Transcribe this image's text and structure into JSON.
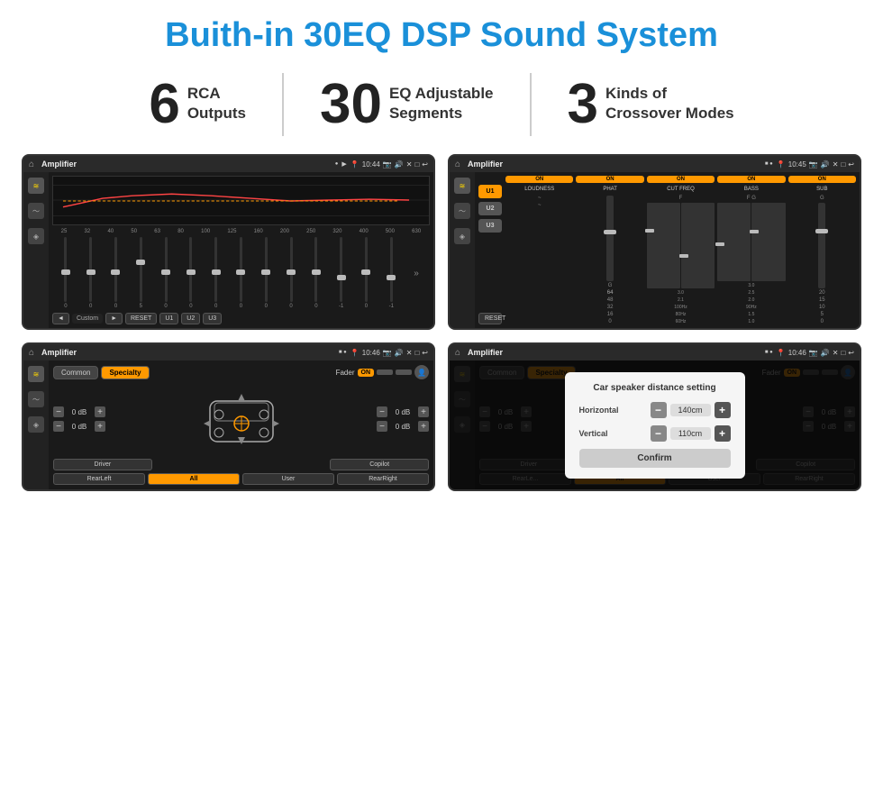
{
  "page": {
    "title": "Buith-in 30EQ DSP Sound System"
  },
  "stats": [
    {
      "number": "6",
      "line1": "RCA",
      "line2": "Outputs"
    },
    {
      "number": "30",
      "line1": "EQ Adjustable",
      "line2": "Segments"
    },
    {
      "number": "3",
      "line1": "Kinds of",
      "line2": "Crossover Modes"
    }
  ],
  "screens": {
    "eq": {
      "status_bar": {
        "app": "Amplifier",
        "time": "10:44"
      },
      "freq_labels": [
        "25",
        "32",
        "40",
        "50",
        "63",
        "80",
        "100",
        "125",
        "160",
        "200",
        "250",
        "320",
        "400",
        "500",
        "630"
      ],
      "slider_values": [
        "0",
        "0",
        "0",
        "5",
        "0",
        "0",
        "0",
        "0",
        "0",
        "0",
        "0",
        "-1",
        "0",
        "-1"
      ],
      "bottom_controls": [
        "◄",
        "Custom",
        "►",
        "RESET",
        "U1",
        "U2",
        "U3"
      ]
    },
    "amp": {
      "status_bar": {
        "app": "Amplifier",
        "time": "10:45"
      },
      "presets": [
        "U1",
        "U2",
        "U3"
      ],
      "controls": [
        {
          "toggle": "ON",
          "label": "LOUDNESS"
        },
        {
          "toggle": "ON",
          "label": "PHAT"
        },
        {
          "toggle": "ON",
          "label": "CUT FREQ"
        },
        {
          "toggle": "ON",
          "label": "BASS"
        },
        {
          "toggle": "ON",
          "label": "SUB"
        }
      ],
      "reset_label": "RESET"
    },
    "crossover": {
      "status_bar": {
        "app": "Amplifier",
        "time": "10:46"
      },
      "tabs": [
        "Common",
        "Specialty"
      ],
      "fader_label": "Fader",
      "fader_on": "ON",
      "db_rows": [
        {
          "value": "0 dB"
        },
        {
          "value": "0 dB"
        }
      ],
      "db_rows_right": [
        {
          "value": "0 dB"
        },
        {
          "value": "0 dB"
        }
      ],
      "bottom_btns": [
        "Driver",
        "",
        "",
        "User",
        "RearLeft",
        "All",
        "",
        "",
        "RearRight",
        "Copilot"
      ]
    },
    "dialog": {
      "status_bar": {
        "app": "Amplifier",
        "time": "10:46"
      },
      "tabs": [
        "Common",
        "Specialty"
      ],
      "dialog": {
        "title": "Car speaker distance setting",
        "horizontal_label": "Horizontal",
        "horizontal_value": "140cm",
        "vertical_label": "Vertical",
        "vertical_value": "110cm",
        "confirm_label": "Confirm"
      },
      "db_rows": [
        {
          "value": "0 dB"
        },
        {
          "value": "0 dB"
        }
      ]
    }
  },
  "icons": {
    "home": "⌂",
    "pin": "📍",
    "camera": "📷",
    "volume": "🔊",
    "back": "↩",
    "settings": "⚙",
    "eq_icon": "≋",
    "wave_icon": "〜",
    "speaker_icon": "◈"
  }
}
